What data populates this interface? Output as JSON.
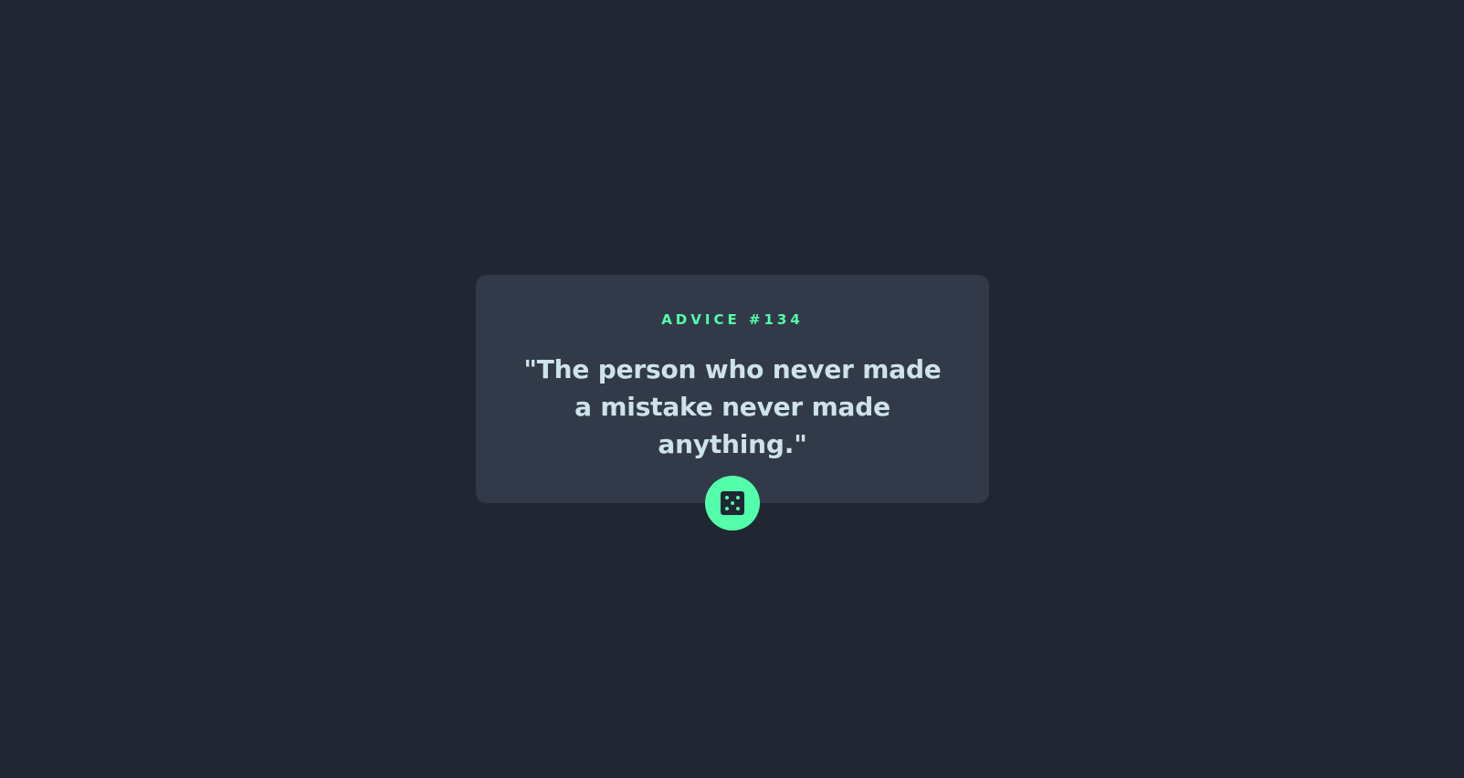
{
  "advice": {
    "id_label": "ADVICE #134",
    "quote": "\"The person who never made a mistake never made anything.\""
  },
  "controls": {
    "dice_button": {
      "icon": "dice-icon",
      "aria_label": "Generate new advice"
    }
  },
  "colors": {
    "background": "#202632",
    "card": "#323a49",
    "accent": "#53ffaa",
    "text": "#cee3e9"
  }
}
